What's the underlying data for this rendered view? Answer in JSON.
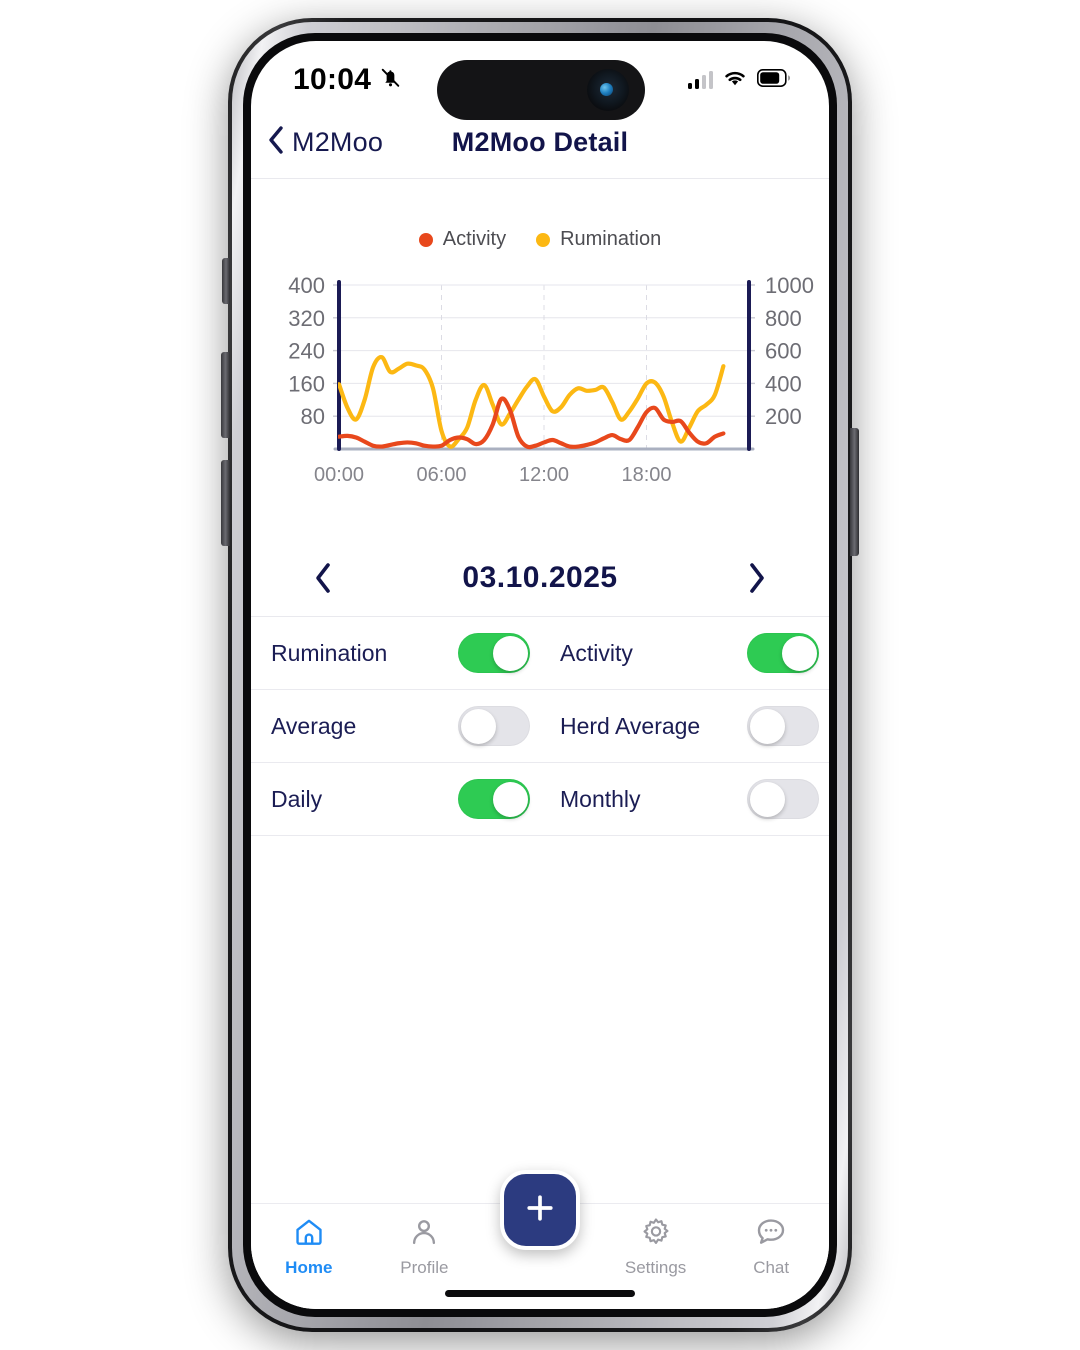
{
  "status_bar": {
    "time": "10:04",
    "silent_icon": "bell-slash-icon",
    "signal_icon": "cellular-signal-icon",
    "signal_bars_filled": 2,
    "signal_bars_total": 4,
    "wifi_icon": "wifi-icon",
    "battery_icon": "battery-icon",
    "battery_level_pct": 75
  },
  "nav": {
    "back_icon": "chevron-left-icon",
    "back_label": "M2Moo",
    "title": "M2Moo Detail"
  },
  "chart_data": {
    "type": "line",
    "title": "",
    "xlabel": "",
    "ylabel": "",
    "grid": true,
    "legend_position": "top-center",
    "legend": [
      {
        "name": "Activity",
        "color": "#e8481c",
        "axis": "left"
      },
      {
        "name": "Rumination",
        "color": "#fcb813",
        "axis": "right"
      }
    ],
    "x_ticks": [
      "00:00",
      "06:00",
      "12:00",
      "18:00"
    ],
    "x_tick_positions_hours": [
      0,
      6,
      12,
      18
    ],
    "x_range_hours": [
      0,
      24
    ],
    "left_axis": {
      "label": "Activity",
      "ticks": [
        80,
        160,
        240,
        320,
        400
      ],
      "range": [
        0,
        400
      ],
      "color": "#1b1b55"
    },
    "right_axis": {
      "label": "Rumination",
      "ticks": [
        200,
        400,
        600,
        800,
        1000
      ],
      "range": [
        0,
        1000
      ],
      "color": "#1b1b55"
    },
    "x": [
      0.0,
      0.5,
      1.0,
      1.5,
      2.0,
      2.5,
      3.0,
      3.5,
      4.0,
      4.5,
      5.0,
      5.5,
      6.0,
      6.5,
      7.0,
      7.5,
      8.0,
      8.5,
      9.0,
      9.5,
      10.0,
      10.5,
      11.0,
      11.5,
      12.0,
      12.5,
      13.0,
      13.5,
      14.0,
      14.5,
      15.0,
      15.5,
      16.0,
      16.5,
      17.0,
      17.5,
      18.0,
      18.5,
      19.0,
      19.5,
      20.0,
      20.5,
      21.0,
      21.5,
      22.0,
      22.5
    ],
    "series": [
      {
        "name": "Activity",
        "color": "#e8481c",
        "axis": "left",
        "values": [
          30,
          32,
          28,
          18,
          8,
          6,
          10,
          14,
          16,
          14,
          8,
          6,
          8,
          22,
          28,
          24,
          12,
          22,
          60,
          122,
          96,
          30,
          6,
          8,
          16,
          22,
          14,
          6,
          6,
          10,
          16,
          26,
          34,
          24,
          22,
          54,
          90,
          100,
          72,
          66,
          68,
          40,
          18,
          14,
          30,
          38
        ]
      },
      {
        "name": "Rumination",
        "color": "#fcb813",
        "axis": "right",
        "values": [
          395,
          250,
          180,
          300,
          500,
          560,
          470,
          490,
          520,
          510,
          485,
          370,
          110,
          15,
          60,
          130,
          300,
          390,
          270,
          150,
          215,
          300,
          380,
          425,
          320,
          230,
          255,
          330,
          370,
          355,
          360,
          375,
          285,
          180,
          230,
          310,
          400,
          405,
          320,
          160,
          45,
          130,
          230,
          270,
          330,
          505
        ]
      }
    ]
  },
  "date_bar": {
    "prev_icon": "chevron-left-icon",
    "date": "03.10.2025",
    "next_icon": "chevron-right-icon"
  },
  "toggles": [
    {
      "left": {
        "label": "Rumination",
        "on": true
      },
      "right": {
        "label": "Activity",
        "on": true
      }
    },
    {
      "left": {
        "label": "Average",
        "on": false
      },
      "right": {
        "label": "Herd Average",
        "on": false
      }
    },
    {
      "left": {
        "label": "Daily",
        "on": true
      },
      "right": {
        "label": "Monthly",
        "on": false
      }
    }
  ],
  "tab_bar": {
    "items": [
      {
        "label": "Home",
        "icon": "home-icon",
        "active": true
      },
      {
        "label": "Profile",
        "icon": "person-icon",
        "active": false
      },
      {
        "label": "Settings",
        "icon": "gear-icon",
        "active": false
      },
      {
        "label": "Chat",
        "icon": "chat-bubble-icon",
        "active": false
      }
    ],
    "fab": {
      "icon": "plus-icon",
      "label": "+"
    }
  },
  "colors": {
    "navy": "#12144a",
    "accent_blue": "#1f8cf5",
    "fab_blue": "#2c3b80",
    "toggle_on": "#2ecb53",
    "toggle_off": "#e4e4e9",
    "activity": "#e8481c",
    "rumination": "#fcb813"
  }
}
